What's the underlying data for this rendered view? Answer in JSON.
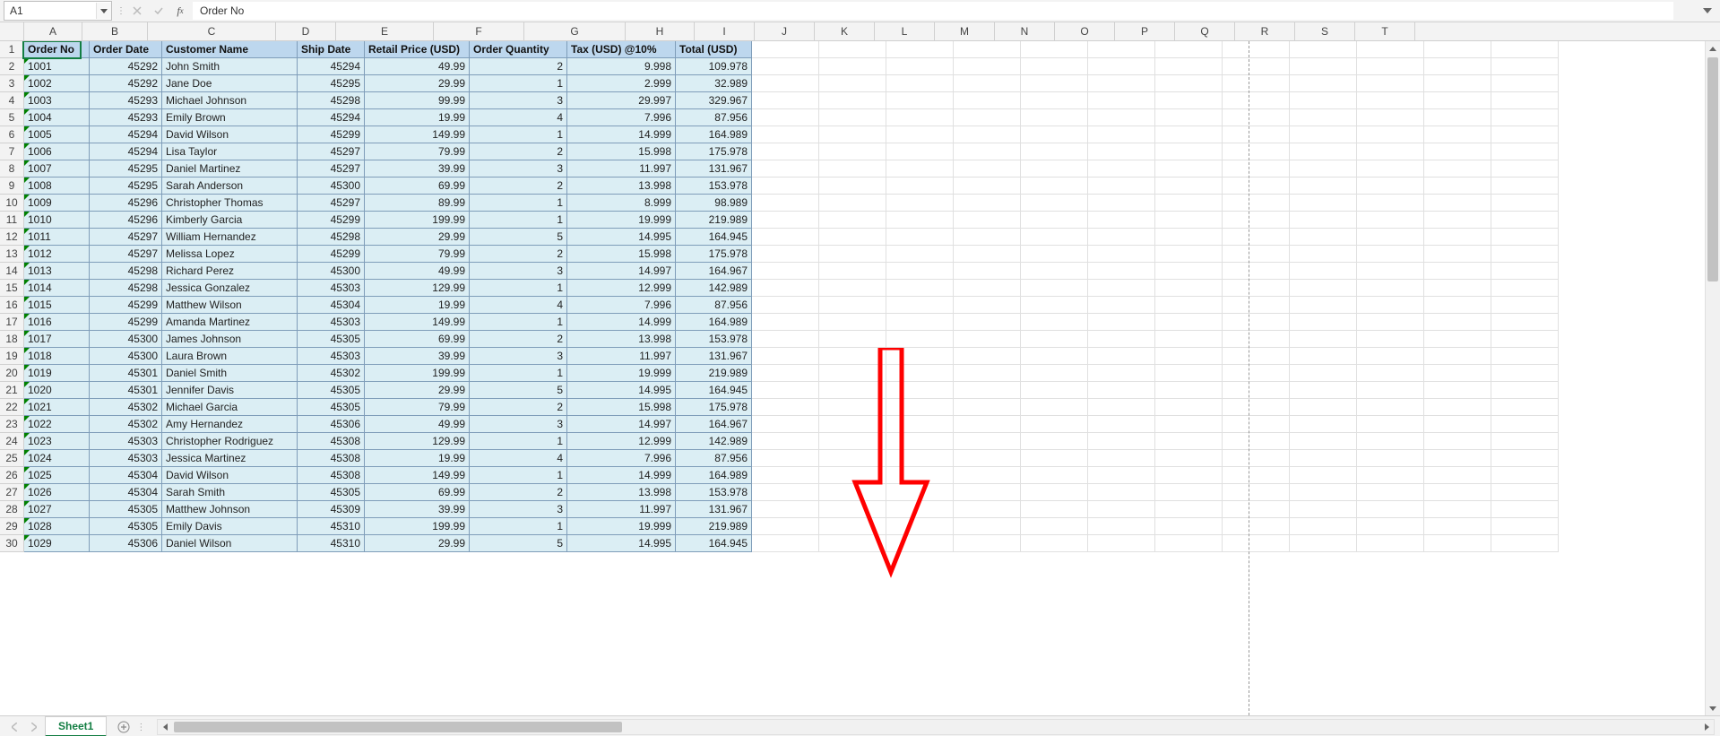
{
  "formula_bar": {
    "name_box": "A1",
    "formula_value": "Order No"
  },
  "columns": [
    "A",
    "B",
    "C",
    "D",
    "E",
    "F",
    "G",
    "H",
    "I",
    "J",
    "K",
    "L",
    "M",
    "N",
    "O",
    "P",
    "Q",
    "R",
    "S",
    "T"
  ],
  "col_widths": {
    "A": 64,
    "B": 72,
    "C": 142,
    "D": 66,
    "E": 108,
    "F": 100,
    "G": 112,
    "H": 76
  },
  "default_col_width": 66,
  "table": {
    "headers": [
      "Order No",
      "Order Date",
      "Customer Name",
      "Ship Date",
      "Retail Price (USD)",
      "Order Quantity",
      "Tax (USD) @10%",
      "Total (USD)"
    ],
    "rows": [
      [
        "1001",
        "45292",
        "John Smith",
        "45294",
        "49.99",
        "2",
        "9.998",
        "109.978"
      ],
      [
        "1002",
        "45292",
        "Jane Doe",
        "45295",
        "29.99",
        "1",
        "2.999",
        "32.989"
      ],
      [
        "1003",
        "45293",
        "Michael Johnson",
        "45298",
        "99.99",
        "3",
        "29.997",
        "329.967"
      ],
      [
        "1004",
        "45293",
        "Emily Brown",
        "45294",
        "19.99",
        "4",
        "7.996",
        "87.956"
      ],
      [
        "1005",
        "45294",
        "David Wilson",
        "45299",
        "149.99",
        "1",
        "14.999",
        "164.989"
      ],
      [
        "1006",
        "45294",
        "Lisa Taylor",
        "45297",
        "79.99",
        "2",
        "15.998",
        "175.978"
      ],
      [
        "1007",
        "45295",
        "Daniel Martinez",
        "45297",
        "39.99",
        "3",
        "11.997",
        "131.967"
      ],
      [
        "1008",
        "45295",
        "Sarah Anderson",
        "45300",
        "69.99",
        "2",
        "13.998",
        "153.978"
      ],
      [
        "1009",
        "45296",
        "Christopher Thomas",
        "45297",
        "89.99",
        "1",
        "8.999",
        "98.989"
      ],
      [
        "1010",
        "45296",
        "Kimberly Garcia",
        "45299",
        "199.99",
        "1",
        "19.999",
        "219.989"
      ],
      [
        "1011",
        "45297",
        "William Hernandez",
        "45298",
        "29.99",
        "5",
        "14.995",
        "164.945"
      ],
      [
        "1012",
        "45297",
        "Melissa Lopez",
        "45299",
        "79.99",
        "2",
        "15.998",
        "175.978"
      ],
      [
        "1013",
        "45298",
        "Richard Perez",
        "45300",
        "49.99",
        "3",
        "14.997",
        "164.967"
      ],
      [
        "1014",
        "45298",
        "Jessica Gonzalez",
        "45303",
        "129.99",
        "1",
        "12.999",
        "142.989"
      ],
      [
        "1015",
        "45299",
        "Matthew Wilson",
        "45304",
        "19.99",
        "4",
        "7.996",
        "87.956"
      ],
      [
        "1016",
        "45299",
        "Amanda Martinez",
        "45303",
        "149.99",
        "1",
        "14.999",
        "164.989"
      ],
      [
        "1017",
        "45300",
        "James Johnson",
        "45305",
        "69.99",
        "2",
        "13.998",
        "153.978"
      ],
      [
        "1018",
        "45300",
        "Laura Brown",
        "45303",
        "39.99",
        "3",
        "11.997",
        "131.967"
      ],
      [
        "1019",
        "45301",
        "Daniel Smith",
        "45302",
        "199.99",
        "1",
        "19.999",
        "219.989"
      ],
      [
        "1020",
        "45301",
        "Jennifer Davis",
        "45305",
        "29.99",
        "5",
        "14.995",
        "164.945"
      ],
      [
        "1021",
        "45302",
        "Michael Garcia",
        "45305",
        "79.99",
        "2",
        "15.998",
        "175.978"
      ],
      [
        "1022",
        "45302",
        "Amy Hernandez",
        "45306",
        "49.99",
        "3",
        "14.997",
        "164.967"
      ],
      [
        "1023",
        "45303",
        "Christopher Rodriguez",
        "45308",
        "129.99",
        "1",
        "12.999",
        "142.989"
      ],
      [
        "1024",
        "45303",
        "Jessica Martinez",
        "45308",
        "19.99",
        "4",
        "7.996",
        "87.956"
      ],
      [
        "1025",
        "45304",
        "David Wilson",
        "45308",
        "149.99",
        "1",
        "14.999",
        "164.989"
      ],
      [
        "1026",
        "45304",
        "Sarah Smith",
        "45305",
        "69.99",
        "2",
        "13.998",
        "153.978"
      ],
      [
        "1027",
        "45305",
        "Matthew Johnson",
        "45309",
        "39.99",
        "3",
        "11.997",
        "131.967"
      ],
      [
        "1028",
        "45305",
        "Emily Davis",
        "45310",
        "199.99",
        "1",
        "19.999",
        "219.989"
      ],
      [
        "1029",
        "45306",
        "Daniel Wilson",
        "45310",
        "29.99",
        "5",
        "14.995",
        "164.945"
      ]
    ]
  },
  "visible_row_count": 30,
  "sheet_tabs": {
    "active": "Sheet1"
  },
  "active_cell": {
    "col": "A",
    "row": 1
  },
  "page_break_after_col": "Q"
}
